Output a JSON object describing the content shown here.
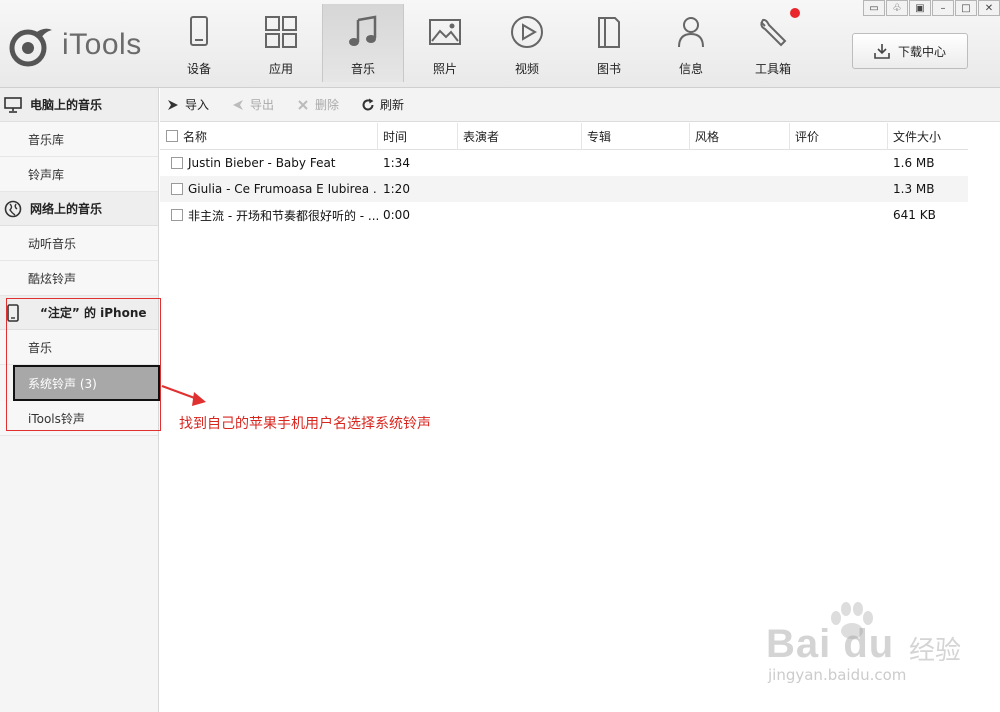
{
  "app": {
    "logo_text": "iTools"
  },
  "nav": {
    "items": [
      {
        "label": "设备",
        "icon": "device-icon"
      },
      {
        "label": "应用",
        "icon": "apps-icon"
      },
      {
        "label": "音乐",
        "icon": "music-icon",
        "active": true
      },
      {
        "label": "照片",
        "icon": "photo-icon"
      },
      {
        "label": "视频",
        "icon": "video-icon"
      },
      {
        "label": "图书",
        "icon": "book-icon"
      },
      {
        "label": "信息",
        "icon": "person-icon"
      },
      {
        "label": "工具箱",
        "icon": "toolbox-icon",
        "badge": true
      }
    ],
    "download_label": "下载中心"
  },
  "sidebar": {
    "sections": [
      {
        "title": "电脑上的音乐",
        "icon": "computer-icon",
        "items": [
          "音乐库",
          "铃声库"
        ]
      },
      {
        "title": "网络上的音乐",
        "icon": "globe-icon",
        "items": [
          "动听音乐",
          "酷炫铃声"
        ]
      },
      {
        "title": "“注定” 的 iPhone",
        "icon": "phone-icon",
        "items": [
          "音乐",
          "系统铃声 (3)",
          "iTools铃声"
        ]
      }
    ]
  },
  "toolbar": {
    "import": "导入",
    "export": "导出",
    "delete": "删除",
    "refresh": "刷新"
  },
  "table": {
    "headers": [
      "名称",
      "时间",
      "表演者",
      "专辑",
      "风格",
      "评价",
      "文件大小"
    ],
    "rows": [
      {
        "name": "Justin Bieber - Baby Feat",
        "time": "1:34",
        "size": "1.6 MB"
      },
      {
        "name": "Giulia - Ce Frumoasa E Iubirea ...",
        "time": "1:20",
        "size": "1.3 MB"
      },
      {
        "name": "非主流 - 开场和节奏都很好听的 - ...",
        "time": "0:00",
        "size": "641 KB"
      }
    ]
  },
  "annotation": {
    "text": "找到自己的苹果手机用户名选择系统铃声",
    "color": "#d8261f"
  },
  "watermark": {
    "brand": "Bai  du",
    "cn": "经验",
    "url": "jingyan.baidu.com"
  },
  "colors": {
    "badge": "#e8262c",
    "annotation": "#d8261f"
  }
}
